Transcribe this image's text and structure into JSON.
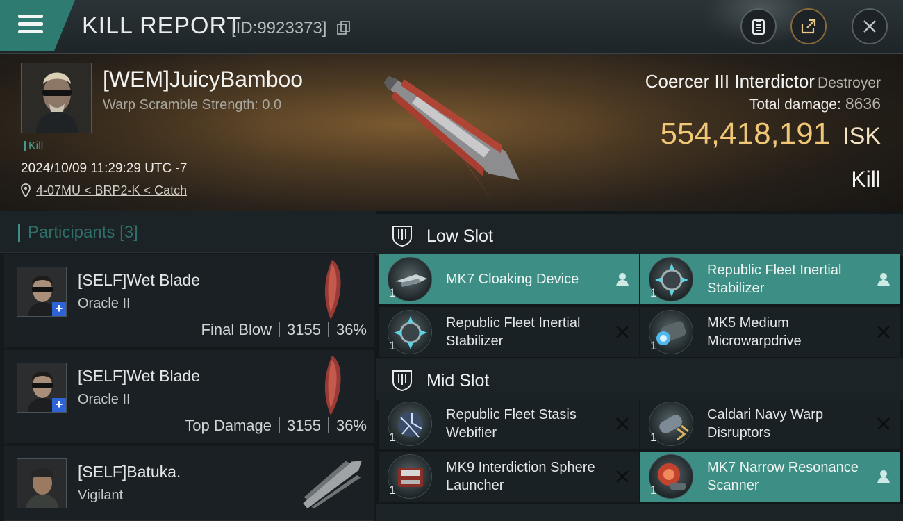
{
  "header": {
    "title": "KILL REPORT",
    "id_text": "[ID:9923373]"
  },
  "victim": {
    "name": "[WEM]JuicyBamboo",
    "warp_scramble": "Warp Scramble Strength: 0.0",
    "tag": "Kill",
    "datetime": "2024/10/09 11:29:29 UTC -7",
    "location": "4-07MU < BRP2-K < Catch",
    "ship_name": "Coercer III Interdictor",
    "ship_class": "Destroyer",
    "total_damage_label": "Total damage:",
    "total_damage": "8636",
    "isk_value": "554,418,191",
    "isk_unit": "ISK",
    "result": "Kill"
  },
  "participants": {
    "title": "Participants",
    "count": "[3]",
    "items": [
      {
        "name": "[SELF]Wet Blade",
        "ship": "Oracle II",
        "role": "Final Blow",
        "damage": "3155",
        "percent": "36%"
      },
      {
        "name": "[SELF]Wet Blade",
        "ship": "Oracle II",
        "role": "Top Damage",
        "damage": "3155",
        "percent": "36%"
      },
      {
        "name": "[SELF]Batuka.",
        "ship": "Vigilant"
      }
    ]
  },
  "slots": {
    "low": {
      "label": "Low Slot",
      "modules": [
        {
          "name": "MK7 Cloaking Device",
          "qty": "1",
          "status": "pilot-icon"
        },
        {
          "name": "Republic Fleet Inertial Stabilizer",
          "qty": "1",
          "status": "pilot-icon"
        },
        {
          "name": "Republic Fleet Inertial Stabilizer",
          "qty": "1",
          "status": "destroyed-icon"
        },
        {
          "name": "MK5 Medium Microwarpdrive",
          "qty": "1",
          "status": "destroyed-icon"
        }
      ]
    },
    "mid": {
      "label": "Mid Slot",
      "modules": [
        {
          "name": "Republic Fleet Stasis Webifier",
          "qty": "1",
          "status": "destroyed-icon"
        },
        {
          "name": "Caldari Navy Warp Disruptors",
          "qty": "1",
          "status": "destroyed-icon"
        },
        {
          "name": "MK9 Interdiction Sphere Launcher",
          "qty": "1",
          "status": "destroyed-icon"
        },
        {
          "name": "MK7 Narrow Resonance Scanner",
          "qty": "1",
          "status": "pilot-icon"
        }
      ]
    }
  },
  "colors": {
    "accent_teal": "#3d8e84",
    "isk_gold": "#f0c777"
  }
}
